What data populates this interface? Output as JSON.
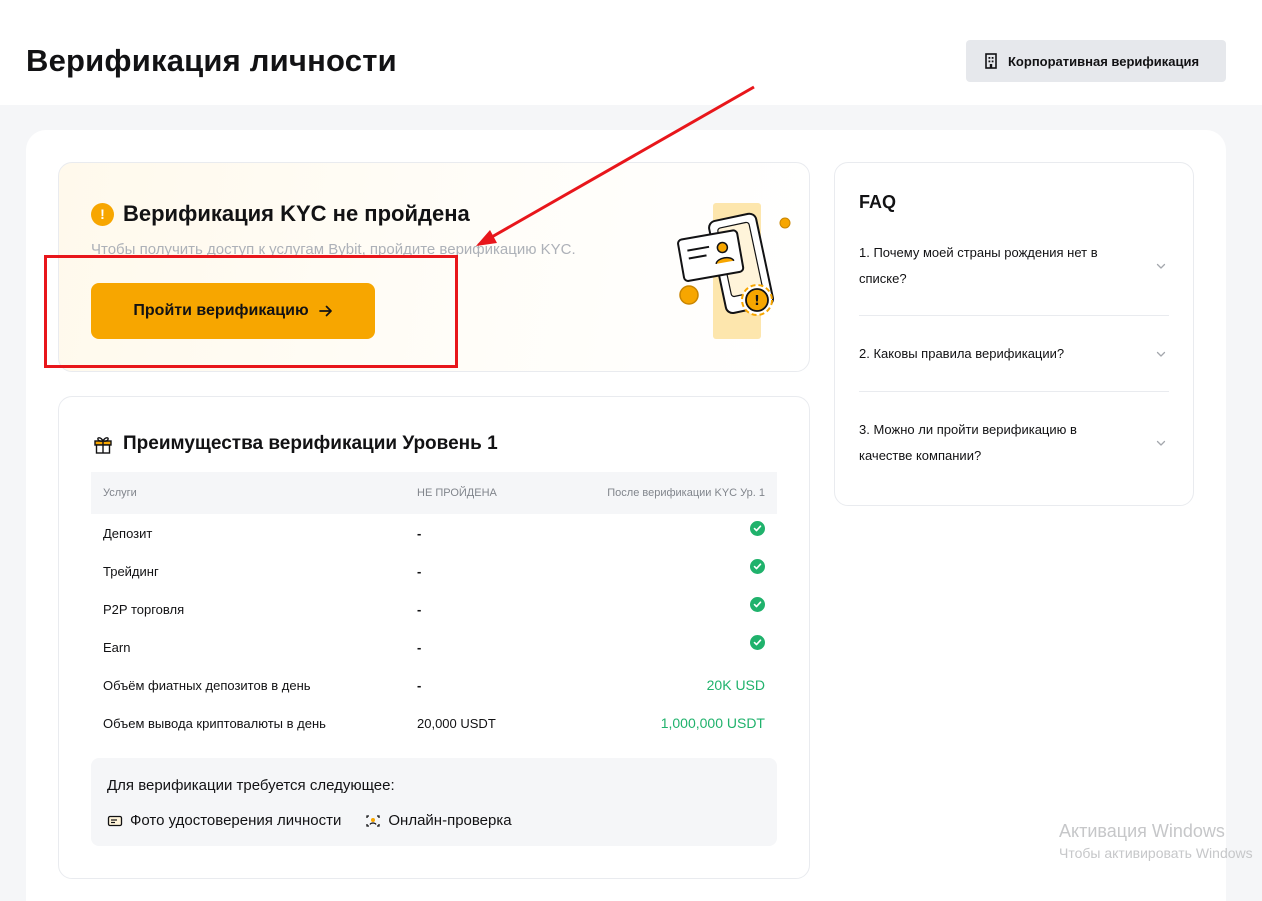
{
  "header": {
    "title": "Верификация личности",
    "corporate_button": "Корпоративная верификация"
  },
  "kyc": {
    "title": "Верификация KYC не пройдена",
    "subtitle": "Чтобы получить доступ к услугам Bybit, пройдите верификацию KYC.",
    "button": "Пройти верификацию"
  },
  "benefits": {
    "title": "Преимущества верификации Уровень 1",
    "columns": [
      "Услуги",
      "НЕ ПРОЙДЕНА",
      "После верификации KYC Ур. 1"
    ],
    "rows": [
      {
        "service": "Депозит",
        "current": "-",
        "after": "check"
      },
      {
        "service": "Трейдинг",
        "current": "-",
        "after": "check"
      },
      {
        "service": "P2P торговля",
        "current": "-",
        "after": "check"
      },
      {
        "service": "Earn",
        "current": "-",
        "after": "check"
      },
      {
        "service": "Объём фиатных депозитов в день",
        "current": "-",
        "after": "20K USD"
      },
      {
        "service": "Объем вывода криптовалюты в день",
        "current": "20,000 USDT",
        "after": "1,000,000 USDT"
      }
    ],
    "requirements": {
      "title": "Для верификации требуется следующее:",
      "items": [
        "Фото удостоверения личности",
        "Онлайн-проверка"
      ]
    }
  },
  "faq": {
    "title": "FAQ",
    "items": [
      "1. Почему моей страны рождения нет в списке?",
      "2. Каковы правила верификации?",
      "3. Можно ли пройти верификацию в качестве компании?"
    ]
  },
  "watermark": {
    "line1": "Активация Windows",
    "line2": "Чтобы активировать Windows"
  },
  "colors": {
    "accent": "#f7a600",
    "success": "#20b26c",
    "annotation": "#e8161b"
  }
}
